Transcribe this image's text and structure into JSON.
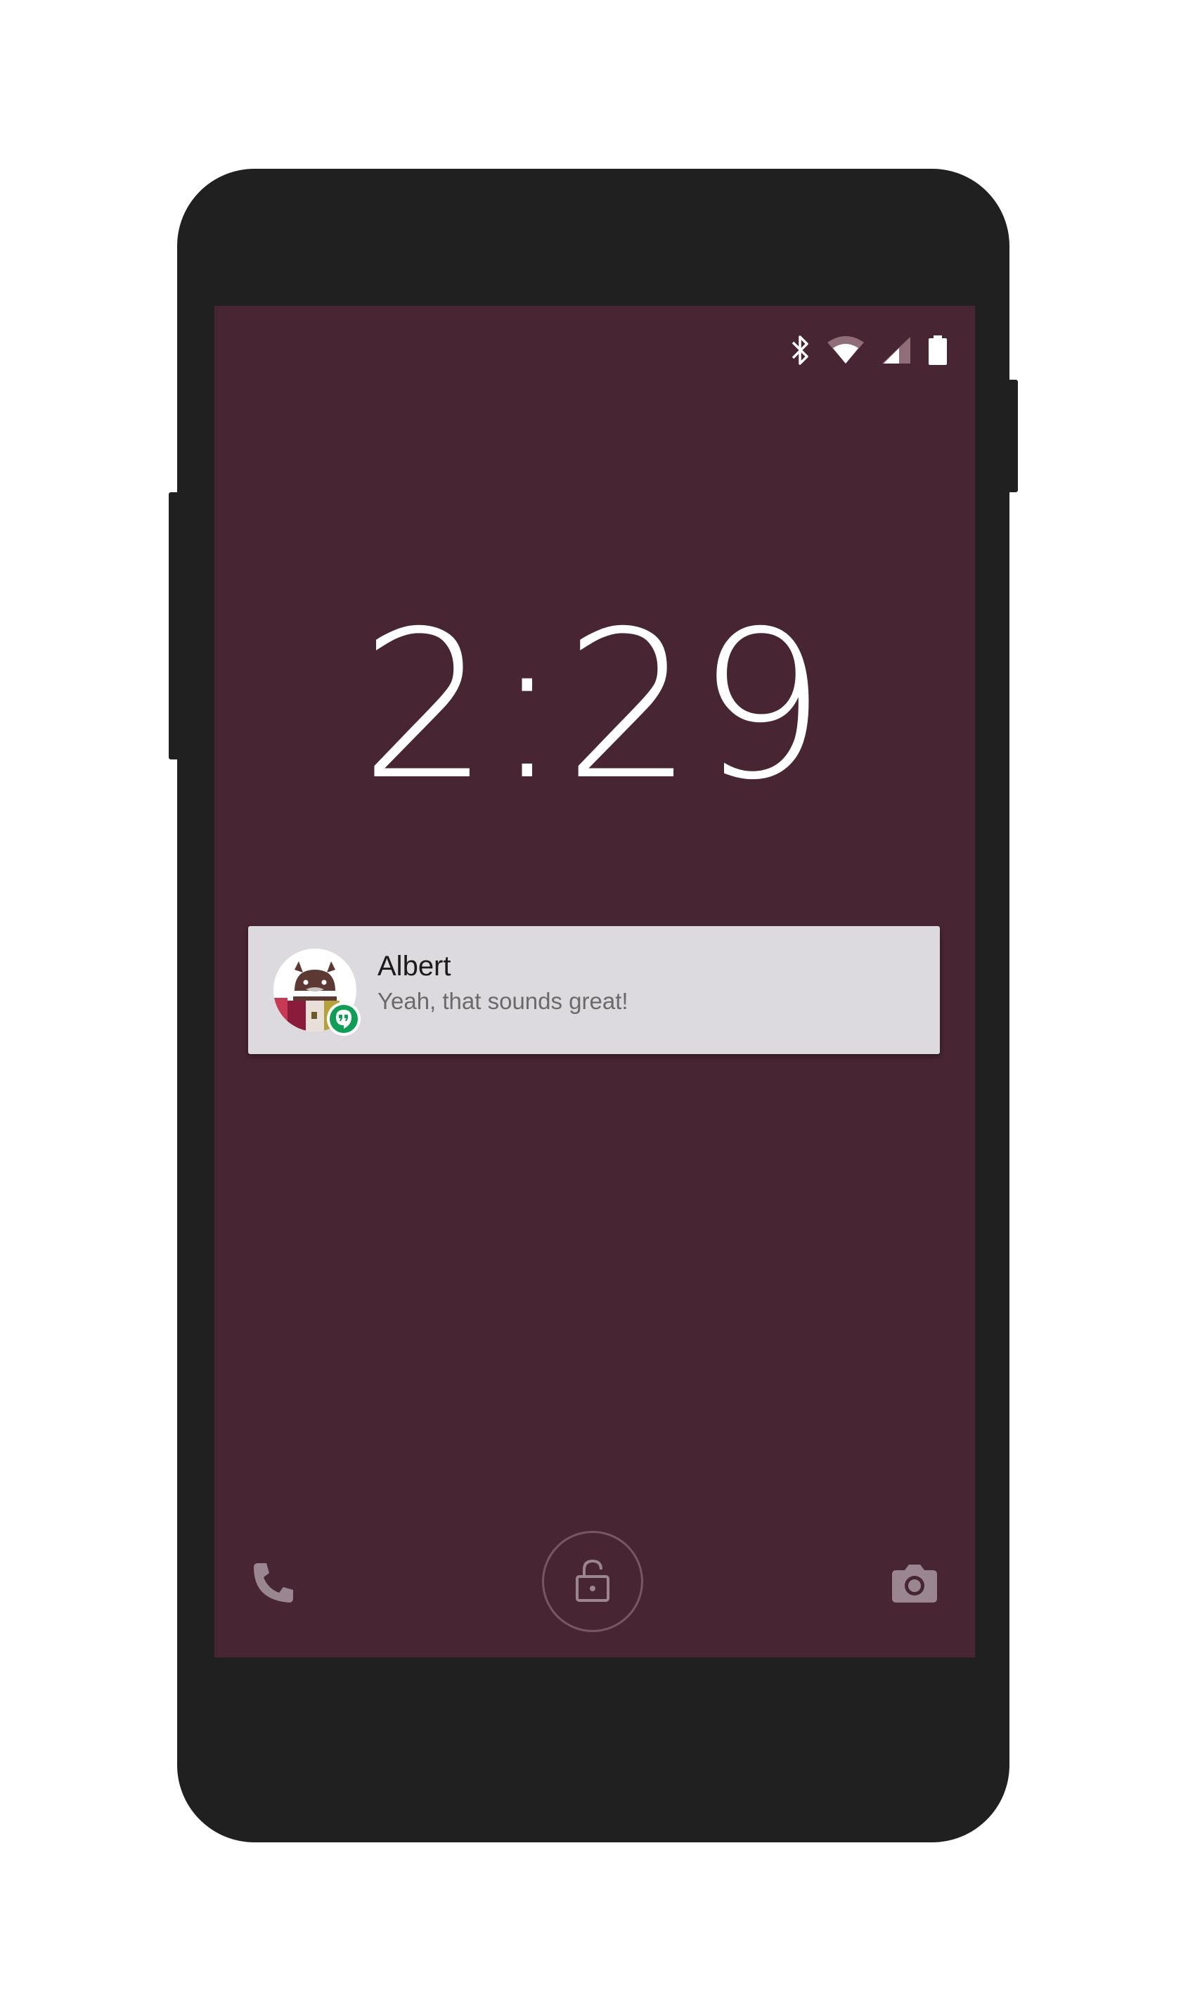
{
  "lockscreen": {
    "time": "2:29",
    "background_color": "#482533"
  },
  "status_bar": {
    "icons": [
      "bluetooth-icon",
      "wifi-icon",
      "cell-signal-icon",
      "battery-icon"
    ]
  },
  "notification": {
    "title": "Albert",
    "text": "Yeah, that sounds great!",
    "app_badge": "hangouts-icon",
    "badge_color": "#0f9d58"
  },
  "bottom_actions": {
    "left_icon": "phone-icon",
    "center_icon": "unlock-icon",
    "right_icon": "camera-icon"
  }
}
